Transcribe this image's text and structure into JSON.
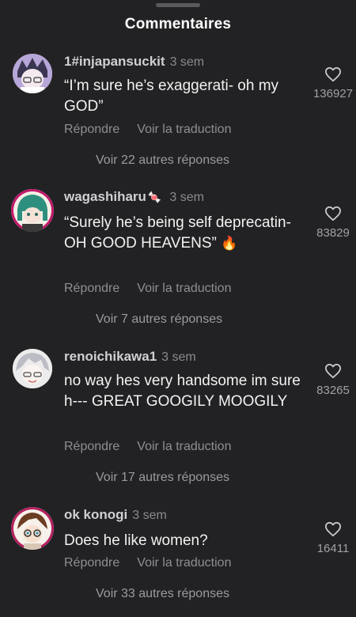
{
  "header": {
    "title": "Commentaires"
  },
  "comments": [
    {
      "username": "1#injapansuckit",
      "time": "3 sem",
      "text": "“I’m sure he’s exaggerati- oh my GOD”",
      "reply": "Répondre",
      "translate": "Voir la traduction",
      "more_replies": "Voir 22 autres réponses",
      "likes": "136927"
    },
    {
      "username": "wagashiharu",
      "time": "3 sem",
      "text": "“Surely he’s being self deprecatin-OH GOOD HEAVENS”",
      "reply": "Répondre",
      "translate": "Voir la traduction",
      "more_replies": "Voir 7 autres réponses",
      "likes": "83829"
    },
    {
      "username": "renoichikawa1",
      "time": "3 sem",
      "text": "no way hes very handsome im sure   h--- GREAT GOOGILY MOOGILY",
      "reply": "Répondre",
      "translate": "Voir la traduction",
      "more_replies": "Voir 17 autres réponses",
      "likes": "83265"
    },
    {
      "username": "ok konogi",
      "time": "3 sem",
      "text": "Does he like women?",
      "reply": "Répondre",
      "translate": "Voir la traduction",
      "more_replies": "Voir 33 autres réponses",
      "likes": "16411"
    }
  ],
  "icons": {
    "like": "heart-outline-icon",
    "fire": "fire-emoji-icon",
    "candy": "candy-emoji-icon"
  }
}
